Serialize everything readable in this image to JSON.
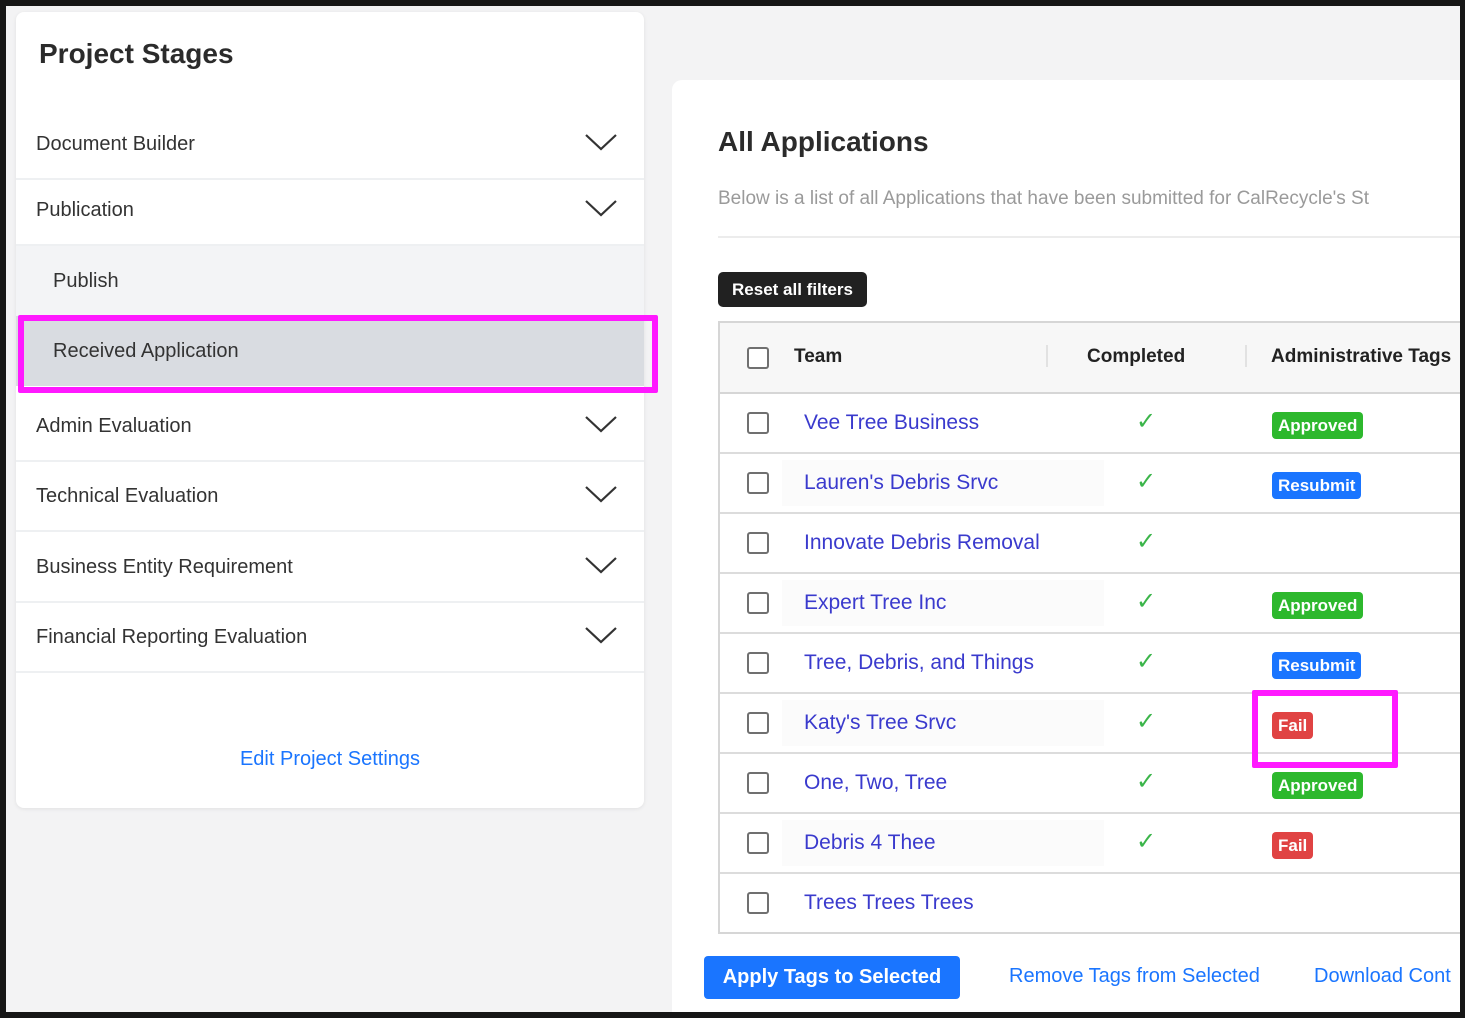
{
  "sidebar": {
    "title": "Project Stages",
    "stages": [
      {
        "label": "Document Builder"
      },
      {
        "label": "Publication"
      },
      {
        "label": "Publish"
      },
      {
        "label": "Received Application"
      },
      {
        "label": "Admin Evaluation"
      },
      {
        "label": "Technical Evaluation"
      },
      {
        "label": "Business Entity Requirement"
      },
      {
        "label": "Financial Reporting Evaluation"
      }
    ],
    "edit_link": "Edit Project Settings"
  },
  "main": {
    "title": "All Applications",
    "description": "Below is a list of all Applications that have been submitted for CalRecycle's St",
    "reset_button": "Reset all filters",
    "columns": [
      "Team",
      "Completed",
      "Administrative Tags"
    ],
    "rows": [
      {
        "team": "Vee Tree Business",
        "completed": "✓",
        "tag": "Approved",
        "tag_type": "approved"
      },
      {
        "team": "Lauren's Debris Srvc",
        "completed": "✓",
        "tag": "Resubmit",
        "tag_type": "resubmit"
      },
      {
        "team": "Innovate Debris Removal",
        "completed": "✓",
        "tag": "",
        "tag_type": ""
      },
      {
        "team": "Expert Tree Inc",
        "completed": "✓",
        "tag": "Approved",
        "tag_type": "approved"
      },
      {
        "team": "Tree, Debris, and Things",
        "completed": "✓",
        "tag": "Resubmit",
        "tag_type": "resubmit"
      },
      {
        "team": "Katy's Tree Srvc",
        "completed": "✓",
        "tag": "Fail",
        "tag_type": "fail"
      },
      {
        "team": "One, Two, Tree",
        "completed": "✓",
        "tag": "Approved",
        "tag_type": "approved"
      },
      {
        "team": "Debris 4 Thee",
        "completed": "✓",
        "tag": "Fail",
        "tag_type": "fail"
      },
      {
        "team": "Trees Trees Trees",
        "completed": "",
        "tag": "",
        "tag_type": ""
      }
    ],
    "apply_button": "Apply Tags to Selected",
    "remove_link": "Remove Tags from Selected",
    "download_link": "Download Cont"
  },
  "colors": {
    "accent": "#1a75ff",
    "highlight": "#ff19ff",
    "approved": "#2db82d",
    "resubmit": "#1a75ff",
    "fail": "#e04343",
    "check": "#3bb54a",
    "team_link": "#3a3acd"
  }
}
